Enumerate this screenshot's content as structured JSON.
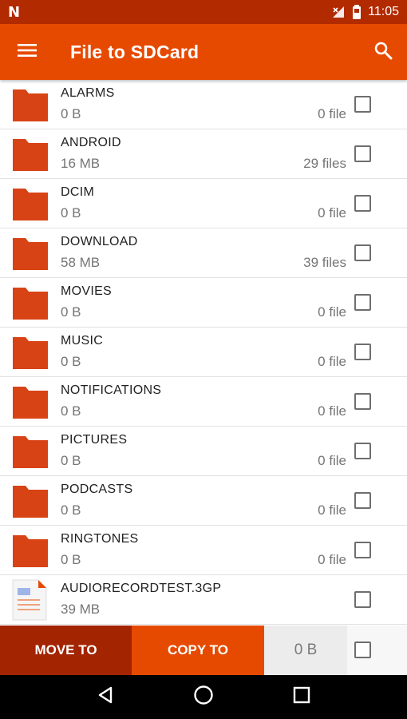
{
  "status_bar": {
    "logo": "N",
    "time": "11:05",
    "icons": [
      "no-signal-icon",
      "battery-icon"
    ]
  },
  "app_bar": {
    "title": "File to SDCard",
    "menu_icon": "hamburger-menu-icon",
    "search_icon": "search-icon"
  },
  "files": [
    {
      "name": "ALARMS",
      "size": "0 B",
      "count": "0 file",
      "type": "folder"
    },
    {
      "name": "ANDROID",
      "size": "16 MB",
      "count": "29 files",
      "type": "folder"
    },
    {
      "name": "DCIM",
      "size": "0 B",
      "count": "0 file",
      "type": "folder"
    },
    {
      "name": "DOWNLOAD",
      "size": "58 MB",
      "count": "39 files",
      "type": "folder"
    },
    {
      "name": "MOVIES",
      "size": "0 B",
      "count": "0 file",
      "type": "folder"
    },
    {
      "name": "MUSIC",
      "size": "0 B",
      "count": "0 file",
      "type": "folder"
    },
    {
      "name": "NOTIFICATIONS",
      "size": "0 B",
      "count": "0 file",
      "type": "folder"
    },
    {
      "name": "PICTURES",
      "size": "0 B",
      "count": "0 file",
      "type": "folder"
    },
    {
      "name": "PODCASTS",
      "size": "0 B",
      "count": "0 file",
      "type": "folder"
    },
    {
      "name": "RINGTONES",
      "size": "0 B",
      "count": "0 file",
      "type": "folder"
    },
    {
      "name": "AUDIORECORDTEST.3GP",
      "size": "39 MB",
      "count": "",
      "type": "file"
    }
  ],
  "actions": {
    "move_label": "MOVE TO",
    "copy_label": "COPY TO",
    "total_size": "0 B"
  },
  "nav": {
    "icons": [
      "back-icon",
      "home-icon",
      "recents-icon"
    ]
  },
  "colors": {
    "status_bar": "#b22a00",
    "app_bar": "#e64a00",
    "folder": "#d84315",
    "move_button": "#a32400",
    "copy_button": "#e64a00"
  }
}
